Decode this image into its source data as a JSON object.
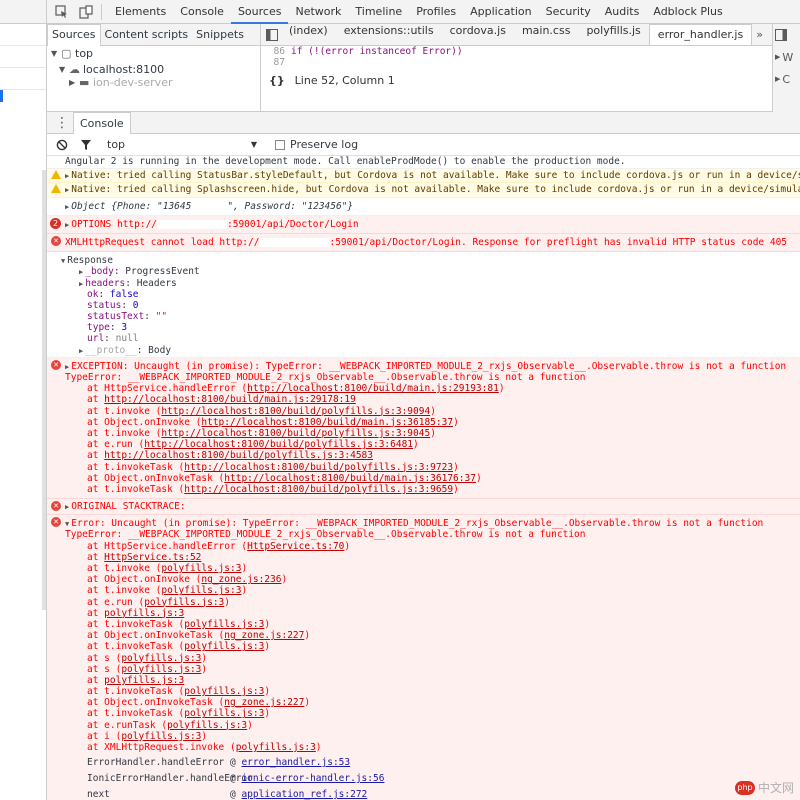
{
  "toolbar": {
    "tabs": [
      "Elements",
      "Console",
      "Sources",
      "Network",
      "Timeline",
      "Profiles",
      "Application",
      "Security",
      "Audits",
      "Adblock Plus"
    ],
    "active_tab": "Sources"
  },
  "navigator": {
    "tabs": [
      "Sources",
      "Content scripts",
      "Snippets"
    ],
    "tree": [
      "top",
      "localhost:8100",
      "ion-dev-server"
    ]
  },
  "editor": {
    "file_tabs": [
      "(index)",
      "extensions::utils",
      "cordova.js",
      "main.css",
      "polyfills.js",
      "error_handler.js"
    ],
    "lines": [
      {
        "n": "86",
        "code": "if (!(error instanceof Error))"
      },
      {
        "n": "87",
        "code": ""
      }
    ],
    "status": "Line 52, Column 1",
    "braces": "{}"
  },
  "right_pane": [
    "W",
    "C"
  ],
  "drawer": {
    "tab": "Console"
  },
  "console_toolbar": {
    "context": "top",
    "preserve_log": "Preserve log"
  },
  "messages": {
    "angular": "Angular 2 is running in the development mode. Call enableProdMode() to enable the production mode.",
    "warn1": "Native: tried calling StatusBar.styleDefault, but Cordova is not available. Make sure to include cordova.js or run in a device/simulator",
    "warn2": "Native: tried calling Splashscreen.hide, but Cordova is not available. Make sure to include cordova.js or run in a device/simulator",
    "object_prefix": "Object {Phone: \"13645",
    "object_suffix": "\", Password: \"123456\"}",
    "options_count": "2",
    "options_prefix": "OPTIONS http://",
    "options_suffix": ":59001/api/Doctor/Login",
    "xhr_prefix": "XMLHttpRequest cannot load http://",
    "xhr_suffix": ":59001/api/Doctor/Login. Response for preflight has invalid HTTP status code 405",
    "response": {
      "title": "Response",
      "body_key": "_body",
      "body_val": "ProgressEvent",
      "headers_key": "headers",
      "headers_val": "Headers",
      "ok_key": "ok",
      "ok_val": "false",
      "status_key": "status",
      "status_val": "0",
      "statusText_key": "statusText",
      "statusText_val": "\"\"",
      "type_key": "type",
      "type_val": "3",
      "url_key": "url",
      "url_val": "null",
      "proto_key": "__proto__",
      "proto_val": "Body"
    },
    "exception": {
      "title": "EXCEPTION: Uncaught (in promise): TypeError: __WEBPACK_IMPORTED_MODULE_2_rxjs_Observable__.Observable.throw is not a function",
      "type_error": "TypeError: __WEBPACK_IMPORTED_MODULE_2_rxjs_Observable__.Observable.throw is not a function",
      "frames": [
        {
          "fn": "at HttpService.handleError (",
          "loc": "http://localhost:8100/build/main.js:29193:81",
          "end": ")"
        },
        {
          "fn": "at ",
          "loc": "http://localhost:8100/build/main.js:29178:19",
          "end": ""
        },
        {
          "fn": "at t.invoke (",
          "loc": "http://localhost:8100/build/polyfills.js:3:9094",
          "end": ")"
        },
        {
          "fn": "at Object.onInvoke (",
          "loc": "http://localhost:8100/build/main.js:36185:37",
          "end": ")"
        },
        {
          "fn": "at t.invoke (",
          "loc": "http://localhost:8100/build/polyfills.js:3:9045",
          "end": ")"
        },
        {
          "fn": "at e.run (",
          "loc": "http://localhost:8100/build/polyfills.js:3:6481",
          "end": ")"
        },
        {
          "fn": "at ",
          "loc": "http://localhost:8100/build/polyfills.js:3:4583",
          "end": ""
        },
        {
          "fn": "at t.invokeTask (",
          "loc": "http://localhost:8100/build/polyfills.js:3:9723",
          "end": ")"
        },
        {
          "fn": "at Object.onInvokeTask (",
          "loc": "http://localhost:8100/build/main.js:36176:37",
          "end": ")"
        },
        {
          "fn": "at t.invokeTask (",
          "loc": "http://localhost:8100/build/polyfills.js:3:9659",
          "end": ")"
        }
      ]
    },
    "original_stacktrace": "ORIGINAL STACKTRACE:",
    "error": {
      "title": "Error: Uncaught (in promise): TypeError: __WEBPACK_IMPORTED_MODULE_2_rxjs_Observable__.Observable.throw is not a function",
      "type_error": "TypeError: __WEBPACK_IMPORTED_MODULE_2_rxjs_Observable__.Observable.throw is not a function",
      "frames": [
        {
          "fn": "at HttpService.handleError (",
          "loc": "HttpService.ts:70",
          "end": ")"
        },
        {
          "fn": "at ",
          "loc": "HttpService.ts:52",
          "end": ""
        },
        {
          "fn": "at t.invoke (",
          "loc": "polyfills.js:3",
          "end": ")"
        },
        {
          "fn": "at Object.onInvoke (",
          "loc": "ng_zone.js:236",
          "end": ")"
        },
        {
          "fn": "at t.invoke (",
          "loc": "polyfills.js:3",
          "end": ")"
        },
        {
          "fn": "at e.run (",
          "loc": "polyfills.js:3",
          "end": ")"
        },
        {
          "fn": "at ",
          "loc": "polyfills.js:3",
          "end": ""
        },
        {
          "fn": "at t.invokeTask (",
          "loc": "polyfills.js:3",
          "end": ")"
        },
        {
          "fn": "at Object.onInvokeTask (",
          "loc": "ng_zone.js:227",
          "end": ")"
        },
        {
          "fn": "at t.invokeTask (",
          "loc": "polyfills.js:3",
          "end": ")"
        },
        {
          "fn": "at s (",
          "loc": "polyfills.js:3",
          "end": ")"
        },
        {
          "fn": "at s (",
          "loc": "polyfills.js:3",
          "end": ")"
        },
        {
          "fn": "at ",
          "loc": "polyfills.js:3",
          "end": ""
        },
        {
          "fn": "at t.invokeTask (",
          "loc": "polyfills.js:3",
          "end": ")"
        },
        {
          "fn": "at Object.onInvokeTask (",
          "loc": "ng_zone.js:227",
          "end": ")"
        },
        {
          "fn": "at t.invokeTask (",
          "loc": "polyfills.js:3",
          "end": ")"
        },
        {
          "fn": "at e.runTask (",
          "loc": "polyfills.js:3",
          "end": ")"
        },
        {
          "fn": "at i (",
          "loc": "polyfills.js:3",
          "end": ")"
        },
        {
          "fn": "at XMLHttpRequest.invoke (",
          "loc": "polyfills.js:3",
          "end": ")"
        }
      ]
    },
    "call_frames": [
      {
        "fn": "ErrorHandler.handleError",
        "at": "@ ",
        "loc": "error_handler.js:53"
      },
      {
        "fn": "IonicErrorHandler.handleError",
        "at": "@ ",
        "loc": "ionic-error-handler.js:56"
      },
      {
        "fn": "next",
        "at": "@ ",
        "loc": "application_ref.js:272"
      }
    ]
  },
  "watermark": {
    "logo": "php",
    "text": "中文网"
  }
}
